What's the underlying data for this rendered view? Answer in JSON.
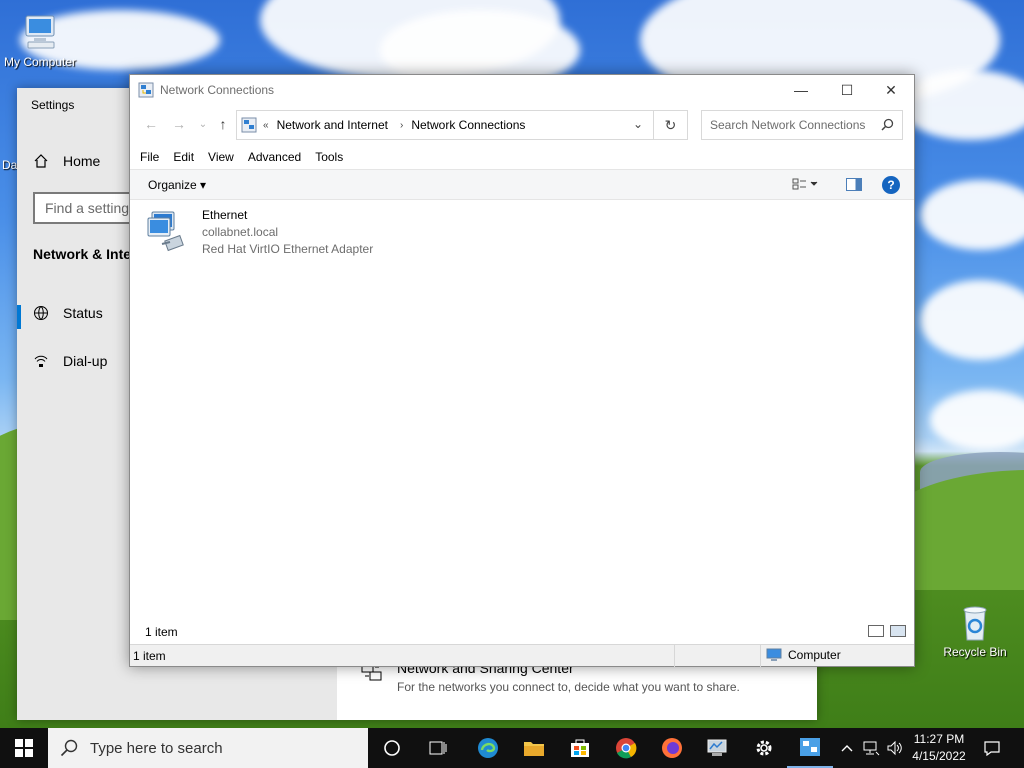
{
  "desktop": {
    "icons": [
      {
        "label": "My Computer",
        "icon": "computer-icon"
      },
      {
        "label": "Recycle Bin",
        "icon": "recycle-bin-icon"
      }
    ],
    "partial_label": "Da"
  },
  "settings": {
    "title": "Settings",
    "home_label": "Home",
    "find_placeholder": "Find a setting",
    "section_title": "Network & Inte",
    "nav": [
      {
        "label": "Status",
        "icon": "globe-icon",
        "active": true
      },
      {
        "label": "Dial-up",
        "icon": "dialup-icon",
        "active": false
      }
    ],
    "sharing_center": {
      "title": "Network and Sharing Center",
      "description": "For the networks you connect to, decide what you want to share."
    }
  },
  "explorer": {
    "title": "Network Connections",
    "window_buttons": {
      "minimize": "—",
      "maximize": "☐",
      "close": "✕"
    },
    "nav": {
      "back": "←",
      "forward": "→",
      "recent": "⌄",
      "up": "↑"
    },
    "address": {
      "prefix": "«",
      "crumbs": [
        "Network and Internet",
        "Network Connections"
      ],
      "dropdown": "⌄",
      "refresh": "↻"
    },
    "search_placeholder": "Search Network Connections",
    "menu": [
      "File",
      "Edit",
      "View",
      "Advanced",
      "Tools"
    ],
    "command_bar": {
      "organize": "Organize ▾"
    },
    "items": [
      {
        "name": "Ethernet",
        "network": "collabnet.local",
        "adapter": "Red Hat VirtIO Ethernet Adapter"
      }
    ],
    "item_count": "1 item",
    "status": {
      "left": "1 item",
      "right": "Computer"
    }
  },
  "taskbar": {
    "search_placeholder": "Type here to search",
    "time": "11:27 PM",
    "date": "4/15/2022"
  },
  "colors": {
    "accent": "#0078d4",
    "taskbar": "#101010"
  }
}
